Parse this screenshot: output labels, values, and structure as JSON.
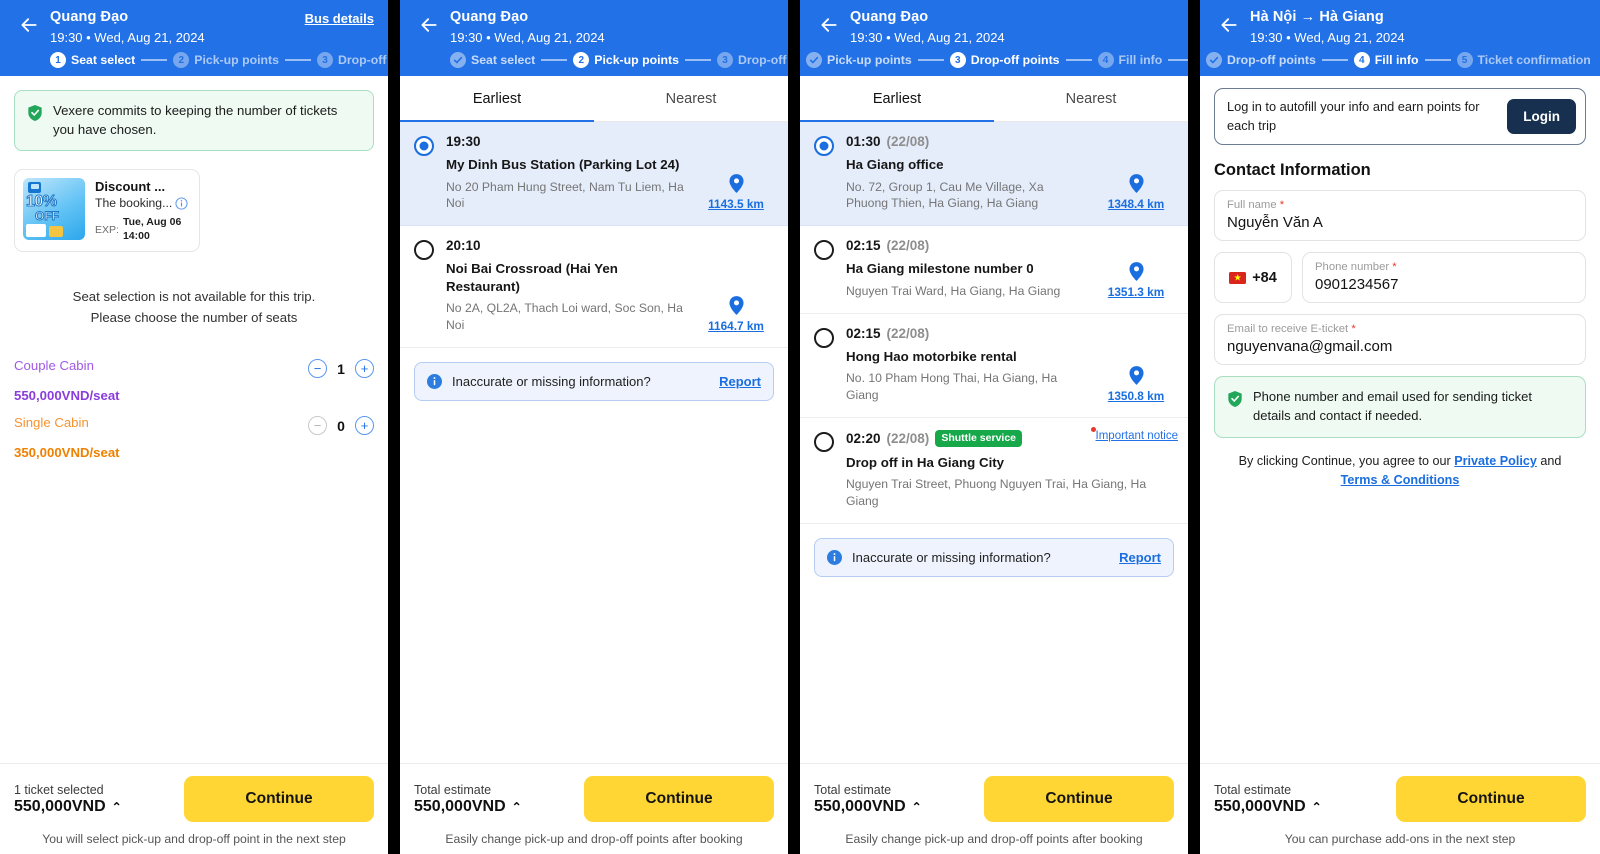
{
  "colors": {
    "header_blue": "#2371e6",
    "continue_yellow": "#ffd633",
    "link_blue": "#1a6ee0",
    "success_green": "#17a84a",
    "login_navy": "#17304f",
    "couple_purple": "#8b3ddb",
    "single_orange": "#ef8100"
  },
  "screen1": {
    "header": {
      "back_icon": "arrow-left-icon",
      "title": "Quang Đạo",
      "subtitle": "19:30 • Wed, Aug 21, 2024",
      "action_label": "Bus details",
      "steps": [
        {
          "num": "1",
          "label": "Seat select",
          "state": "active"
        },
        {
          "num": "2",
          "label": "Pick-up points",
          "state": "todo"
        },
        {
          "num": "3",
          "label": "Drop-off points",
          "state": "todo"
        }
      ]
    },
    "commit_notice": {
      "icon": "shield-check-icon",
      "text": "Vexere commits to keeping the number of tickets you have chosen."
    },
    "promo": {
      "image_badge_percent": "10%",
      "image_badge_off": "OFF",
      "title": "Discount ...",
      "description": "The booking...",
      "info_icon": "info-icon",
      "exp_label": "EXP:",
      "exp_value": "Tue, Aug 06 14:00"
    },
    "seat_message_line1": "Seat selection is not available for this trip.",
    "seat_message_line2": "Please choose the number of seats",
    "cabins": [
      {
        "name": "Couple Cabin",
        "price": "550,000VND/seat",
        "qty": "1",
        "minus_enabled": true,
        "color": "purple"
      },
      {
        "name": "Single Cabin",
        "price": "350,000VND/seat",
        "qty": "0",
        "minus_enabled": false,
        "color": "orange"
      }
    ],
    "footer": {
      "label": "1 ticket selected",
      "amount": "550,000VND",
      "caret": "⌃",
      "continue_label": "Continue",
      "note": "You will select pick-up and drop-off point in the next step"
    }
  },
  "screen2": {
    "header": {
      "back_icon": "arrow-left-icon",
      "title": "Quang Đạo",
      "subtitle": "19:30 • Wed, Aug 21, 2024",
      "steps": [
        {
          "num": "✓",
          "label": "Seat select",
          "state": "done"
        },
        {
          "num": "2",
          "label": "Pick-up points",
          "state": "active"
        },
        {
          "num": "3",
          "label": "Drop-off points",
          "state": "todo"
        }
      ]
    },
    "tabs": [
      {
        "label": "Earliest",
        "active": true
      },
      {
        "label": "Nearest",
        "active": false
      }
    ],
    "points": [
      {
        "time": "19:30",
        "date": "",
        "badge": "",
        "name": "My Dinh Bus Station (Parking Lot 24)",
        "address": "No 20 Pham Hung Street, Nam Tu Liem, Ha Noi",
        "distance": "1143.5 km",
        "selected": true,
        "notice": ""
      },
      {
        "time": "20:10",
        "date": "",
        "badge": "",
        "name": "Noi Bai Crossroad (Hai Yen Restaurant)",
        "address": "No 2A, QL2A, Thach Loi ward, Soc Son, Ha Noi",
        "distance": "1164.7 km",
        "selected": false,
        "notice": ""
      }
    ],
    "report": {
      "icon": "info-circle-icon",
      "text": "Inaccurate or missing information?",
      "link": "Report"
    },
    "footer": {
      "label": "Total estimate",
      "amount": "550,000VND",
      "caret": "⌃",
      "continue_label": "Continue",
      "note": "Easily change pick-up and drop-off points after booking"
    }
  },
  "screen3": {
    "header": {
      "back_icon": "arrow-left-icon",
      "title": "Quang Đạo",
      "subtitle": "19:30 • Wed, Aug 21, 2024",
      "steps": [
        {
          "num": "✓",
          "label": "Pick-up points",
          "state": "done"
        },
        {
          "num": "3",
          "label": "Drop-off points",
          "state": "active"
        },
        {
          "num": "4",
          "label": "Fill info",
          "state": "todo"
        }
      ]
    },
    "tabs": [
      {
        "label": "Earliest",
        "active": true
      },
      {
        "label": "Nearest",
        "active": false
      }
    ],
    "points": [
      {
        "time": "01:30",
        "date": "(22/08)",
        "badge": "",
        "name": "Ha Giang office",
        "address": "No. 72, Group 1, Cau Me Village, Xa Phuong Thien, Ha Giang, Ha Giang",
        "distance": "1348.4 km",
        "selected": true,
        "notice": ""
      },
      {
        "time": "02:15",
        "date": "(22/08)",
        "badge": "",
        "name": "Ha Giang milestone number 0",
        "address": "Nguyen Trai Ward, Ha Giang, Ha Giang",
        "distance": "1351.3 km",
        "selected": false,
        "notice": ""
      },
      {
        "time": "02:15",
        "date": "(22/08)",
        "badge": "",
        "name": "Hong Hao motorbike rental",
        "address": "No. 10 Pham Hong Thai, Ha Giang, Ha Giang",
        "distance": "1350.8 km",
        "selected": false,
        "notice": ""
      },
      {
        "time": "02:20",
        "date": "(22/08)",
        "badge": "Shuttle service",
        "name": "Drop off in Ha Giang City",
        "address": "Nguyen Trai Street, Phuong Nguyen Trai, Ha Giang, Ha Giang",
        "distance": "",
        "selected": false,
        "notice": "Important notice"
      }
    ],
    "report": {
      "icon": "info-circle-icon",
      "text": "Inaccurate or missing information?",
      "link": "Report"
    },
    "footer": {
      "label": "Total estimate",
      "amount": "550,000VND",
      "caret": "⌃",
      "continue_label": "Continue",
      "note": "Easily change pick-up and drop-off points after booking"
    }
  },
  "screen4": {
    "header": {
      "back_icon": "arrow-left-icon",
      "title": "Hà Nội → Hà Giang",
      "subtitle": "19:30 • Wed, Aug 21, 2024",
      "steps": [
        {
          "num": "✓",
          "label": "Drop-off points",
          "state": "done"
        },
        {
          "num": "4",
          "label": "Fill info",
          "state": "active"
        },
        {
          "num": "5",
          "label": "Ticket confirmation",
          "state": "todo"
        }
      ]
    },
    "login_box": {
      "text": "Log in to autofill your info and earn points for each trip",
      "button_label": "Login"
    },
    "section_title": "Contact Information",
    "fields": {
      "full_name": {
        "label": "Full name",
        "required": "*",
        "value": "Nguyễn Văn A"
      },
      "country_code": {
        "flag": "vietnam-flag-icon",
        "value": "+84"
      },
      "phone": {
        "label": "Phone number",
        "required": "*",
        "value": "0901234567"
      },
      "email": {
        "label": "Email to receive E-ticket",
        "required": "*",
        "value": "nguyenvana@gmail.com"
      }
    },
    "green_note": {
      "icon": "shield-check-icon",
      "text": "Phone number and email used for sending ticket details and contact if needed."
    },
    "terms": {
      "prefix": "By clicking Continue, you agree to our ",
      "link1": "Private Policy",
      "middle": " and ",
      "link2": "Terms & Conditions"
    },
    "footer": {
      "label": "Total estimate",
      "amount": "550,000VND",
      "caret": "⌃",
      "continue_label": "Continue",
      "note": "You can purchase add-ons in the next step"
    }
  }
}
